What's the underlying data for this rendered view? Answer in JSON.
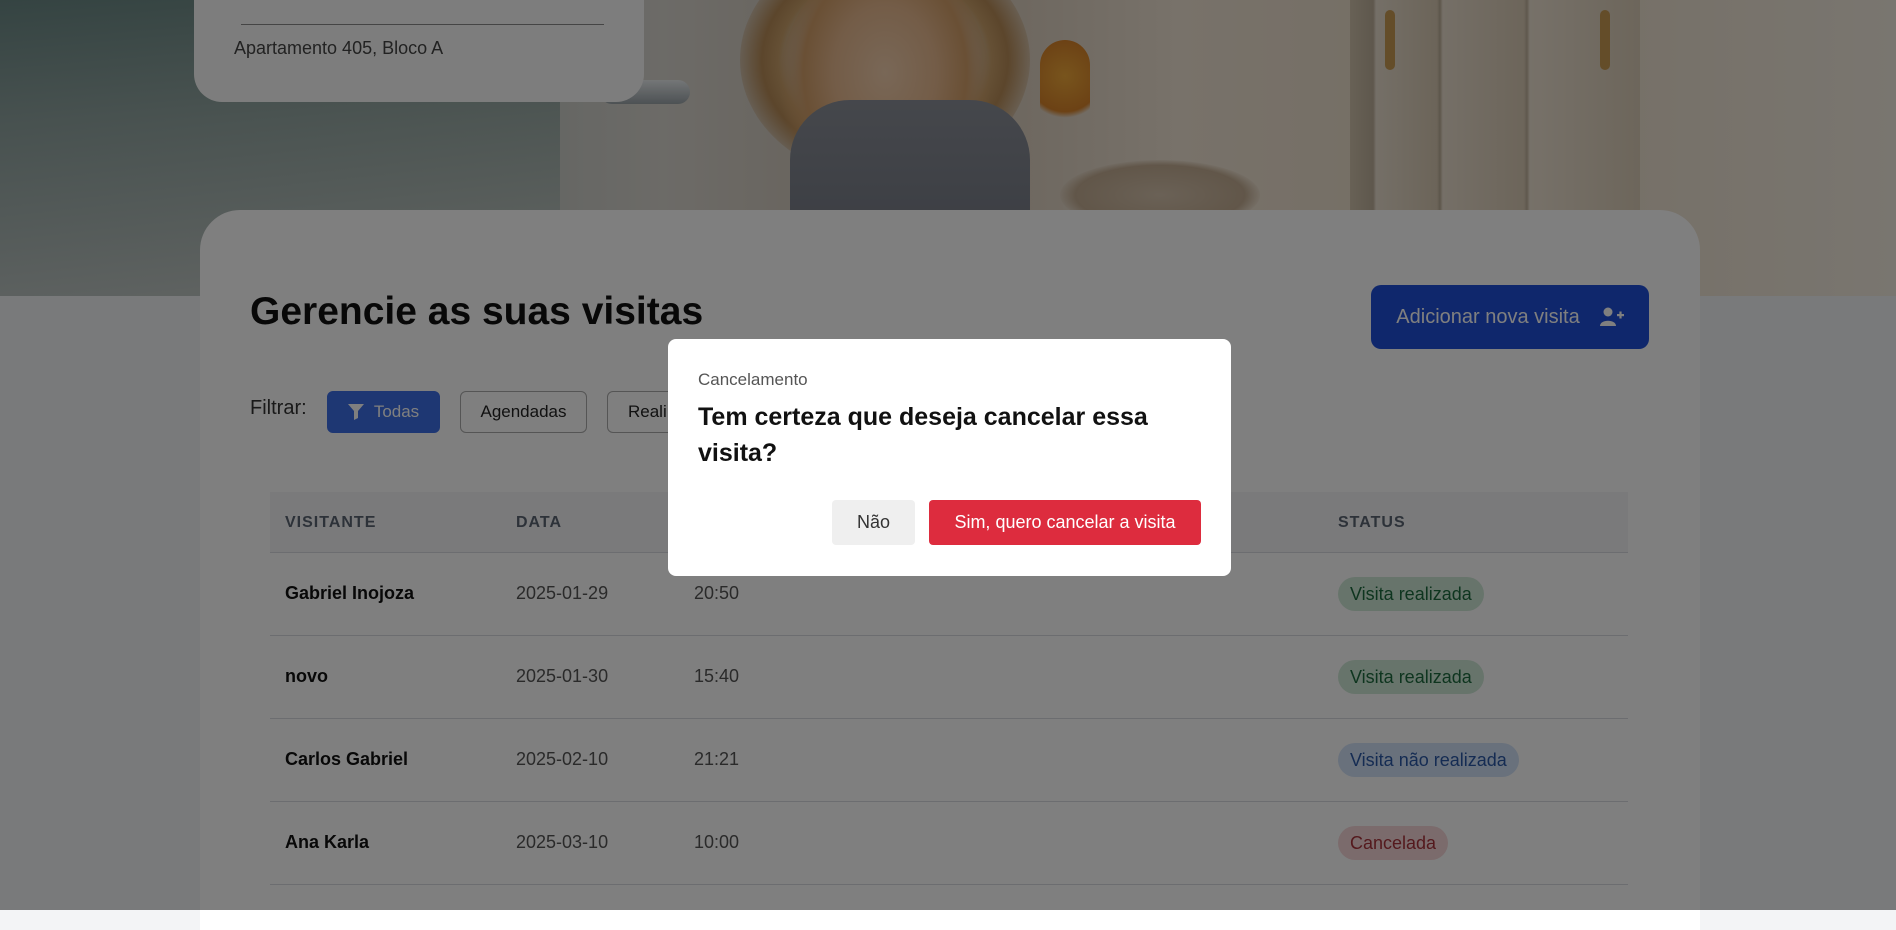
{
  "header": {
    "address": "Apartamento 405, Bloco A"
  },
  "main": {
    "title": "Gerencie as suas visitas",
    "add_button_label": "Adicionar nova visita",
    "filter_label": "Filtrar:",
    "filters": [
      {
        "label": "Todas",
        "active": true
      },
      {
        "label": "Agendadas",
        "active": false
      },
      {
        "label": "Reali",
        "active": false
      }
    ]
  },
  "table": {
    "headers": {
      "visitor": "VISITANTE",
      "date": "DATA",
      "status": "STATUS"
    },
    "rows": [
      {
        "visitor": "Gabriel Inojoza",
        "date": "2025-01-29",
        "time": "20:50",
        "status": "Visita realizada",
        "status_kind": "done"
      },
      {
        "visitor": "novo",
        "date": "2025-01-30",
        "time": "15:40",
        "status": "Visita realizada",
        "status_kind": "done"
      },
      {
        "visitor": "Carlos Gabriel",
        "date": "2025-02-10",
        "time": "21:21",
        "status": "Visita não realizada",
        "status_kind": "notdone"
      },
      {
        "visitor": "Ana Karla",
        "date": "2025-03-10",
        "time": "10:00",
        "status": "Cancelada",
        "status_kind": "cancel"
      }
    ]
  },
  "modal": {
    "subtitle": "Cancelamento",
    "title": "Tem certeza que deseja cancelar essa visita?",
    "no_label": "Não",
    "yes_label": "Sim, quero cancelar a visita"
  },
  "colors": {
    "primary": "#1e4fd8",
    "filter_active": "#3c6ee6",
    "danger": "#dd2c3e",
    "status_done_bg": "#cfe9d7",
    "status_notdone_bg": "#d3e2f8",
    "status_cancel_bg": "#f7d6d8"
  },
  "icons": {
    "add_visit": "user-plus-icon",
    "filter": "funnel-icon"
  }
}
